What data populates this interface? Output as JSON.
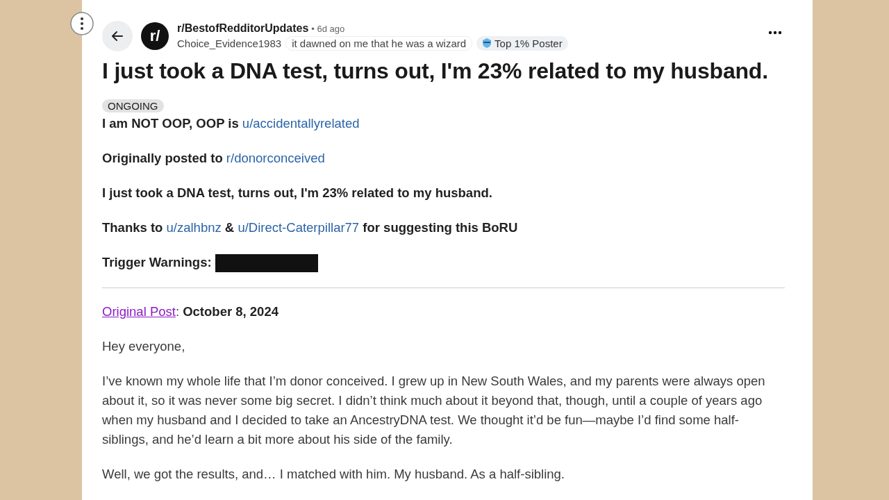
{
  "header": {
    "avatar_text": "r/",
    "subreddit": "r/BestofRedditorUpdates",
    "time": "• 6d ago",
    "author": "Choice_Evidence1983",
    "user_flair": "it dawned on me that he was a wizard",
    "badge": "Top 1% Poster"
  },
  "title": "I just took a DNA test, turns out, I'm 23% related to my husband.",
  "post_flair": "ONGOING",
  "intro": [
    [
      {
        "kind": "text",
        "text": "**I am NOT OOP, OOP is** "
      },
      {
        "kind": "link",
        "visited": false,
        "text": "u/accidentallyrelated"
      }
    ],
    [
      {
        "kind": "text",
        "text": "**Originally posted to** "
      },
      {
        "kind": "link",
        "visited": false,
        "text": "r/donorconceived"
      }
    ],
    [
      {
        "kind": "text",
        "text": "**I just took a DNA test, turns out, I'm 23% related to my husband.**"
      }
    ],
    [
      {
        "kind": "text",
        "text": "**Thanks to** "
      },
      {
        "kind": "link",
        "visited": false,
        "text": "u/zalhbnz"
      },
      {
        "kind": "text",
        "text": " **&** "
      },
      {
        "kind": "link",
        "visited": false,
        "text": "u/Direct-Caterpillar77"
      },
      {
        "kind": "text",
        "text": " **for suggesting this BoRU**"
      }
    ],
    [
      {
        "kind": "text",
        "text": "**Trigger Warnings:** "
      },
      {
        "kind": "spoiler"
      }
    ]
  ],
  "body": [
    [
      {
        "kind": "link",
        "visited": true,
        "text": "Original Post"
      },
      {
        "kind": "text",
        "text": ": **October 8, 2024**"
      }
    ],
    [
      {
        "kind": "text",
        "text": "Hey everyone,"
      }
    ],
    [
      {
        "kind": "text",
        "text": "I’ve known my whole life that I’m donor conceived. I grew up in New South Wales, and my parents were always open about it, so it was never some big secret. I didn’t think much about it beyond that, though, until a couple of years ago when my husband and I decided to take an AncestryDNA test. We thought it’d be fun—maybe I’d find some half-siblings, and he’d learn a bit more about his side of the family."
      }
    ],
    [
      {
        "kind": "text",
        "text": "Well, we got the results, and… I matched with him. My husband. As a half-sibling."
      }
    ]
  ]
}
